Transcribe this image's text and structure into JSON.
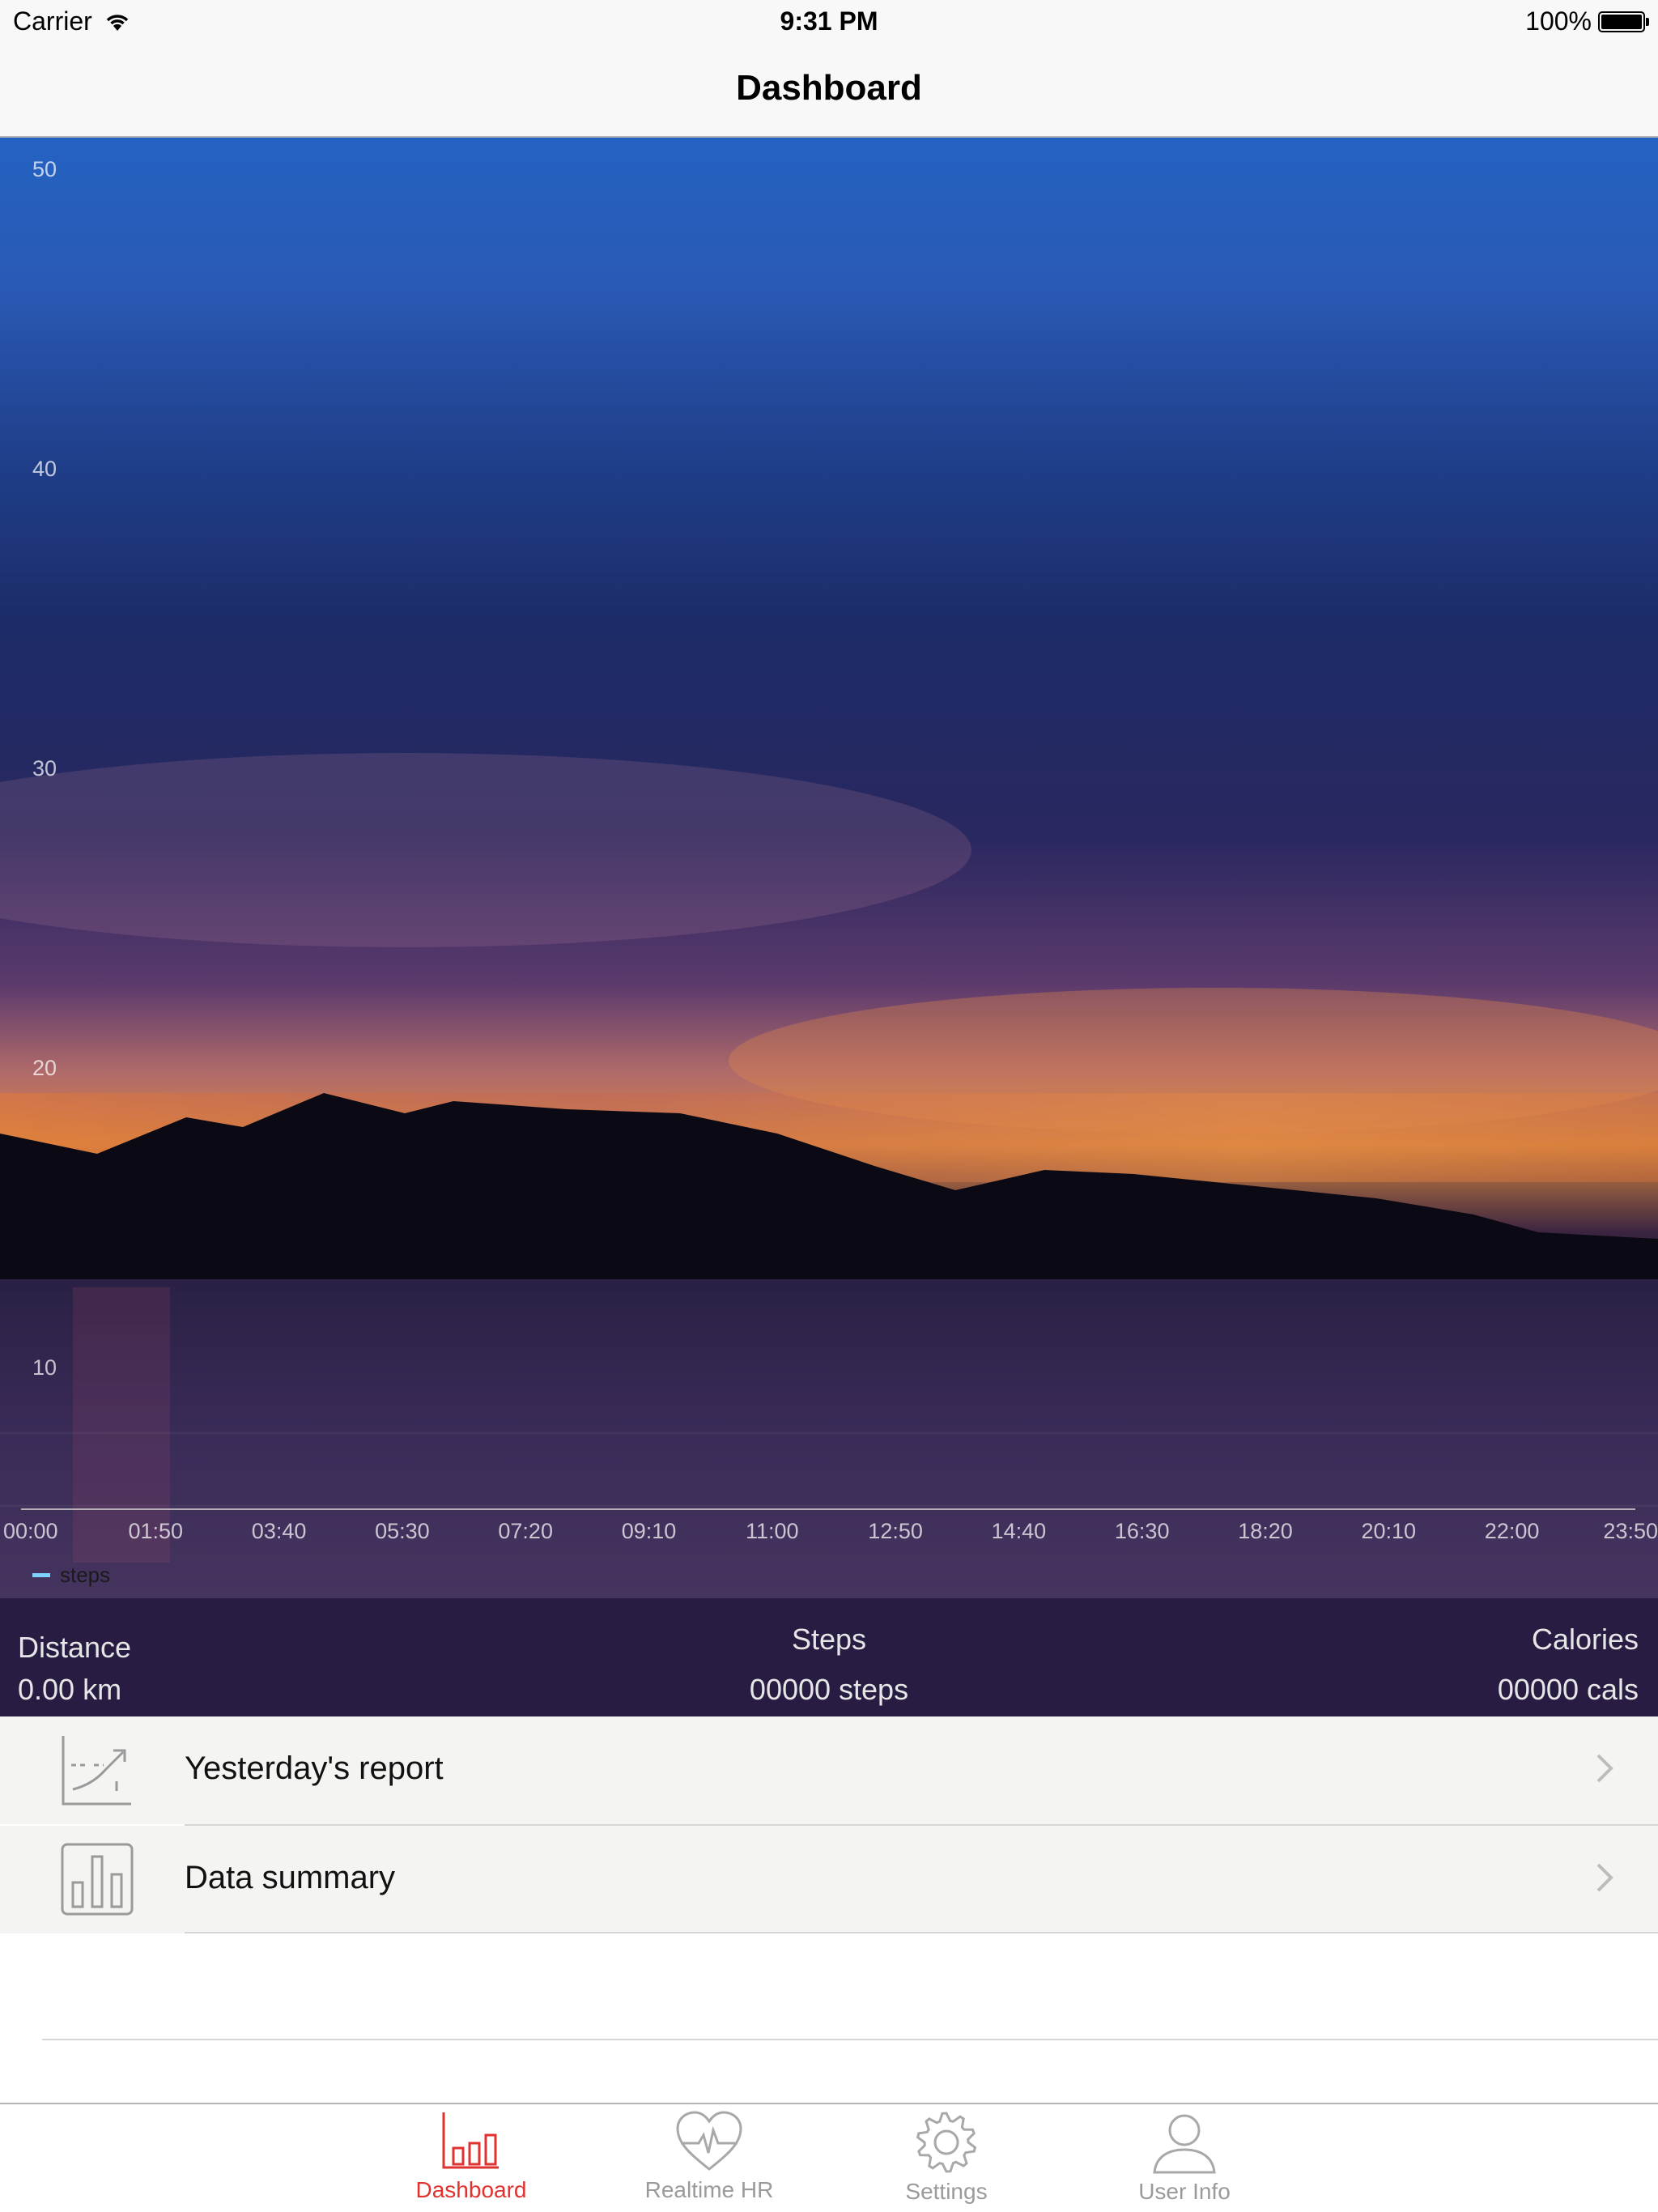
{
  "status_bar": {
    "carrier": "Carrier",
    "time": "9:31 PM",
    "battery_text": "100%",
    "battery_level": 1.0
  },
  "nav": {
    "title": "Dashboard"
  },
  "chart_data": {
    "type": "line",
    "y_ticks": [
      "50",
      "40",
      "30",
      "20",
      "10"
    ],
    "x_ticks": [
      "00:00",
      "01:50",
      "03:40",
      "05:30",
      "07:20",
      "09:10",
      "11:00",
      "12:50",
      "14:40",
      "16:30",
      "18:20",
      "20:10",
      "22:00",
      "23:50"
    ],
    "ylim": [
      0,
      50
    ],
    "series": [
      {
        "name": "steps",
        "values": []
      }
    ],
    "legend_position": "bottom-left",
    "colors": {
      "series": "#7fd3ff",
      "axis": "#cfcfcf"
    }
  },
  "stats": {
    "distance": {
      "label": "Distance",
      "value": "0.00 km"
    },
    "steps": {
      "label": "Steps",
      "value": "00000 steps"
    },
    "calories": {
      "label": "Calories",
      "value": "00000 cals"
    }
  },
  "menu": {
    "items": [
      {
        "label": "Yesterday's report",
        "icon": "trend-chart-icon"
      },
      {
        "label": "Data summary",
        "icon": "bar-chart-icon"
      }
    ]
  },
  "tabs": [
    {
      "label": "Dashboard",
      "icon": "bar-chart-icon",
      "active": true
    },
    {
      "label": "Realtime HR",
      "icon": "heart-pulse-icon",
      "active": false
    },
    {
      "label": "Settings",
      "icon": "gear-icon",
      "active": false
    },
    {
      "label": "User Info",
      "icon": "user-icon",
      "active": false
    }
  ],
  "colors": {
    "accent": "#e0322f",
    "stats_bg": "#281c42",
    "inactive": "#9a9a9a"
  }
}
